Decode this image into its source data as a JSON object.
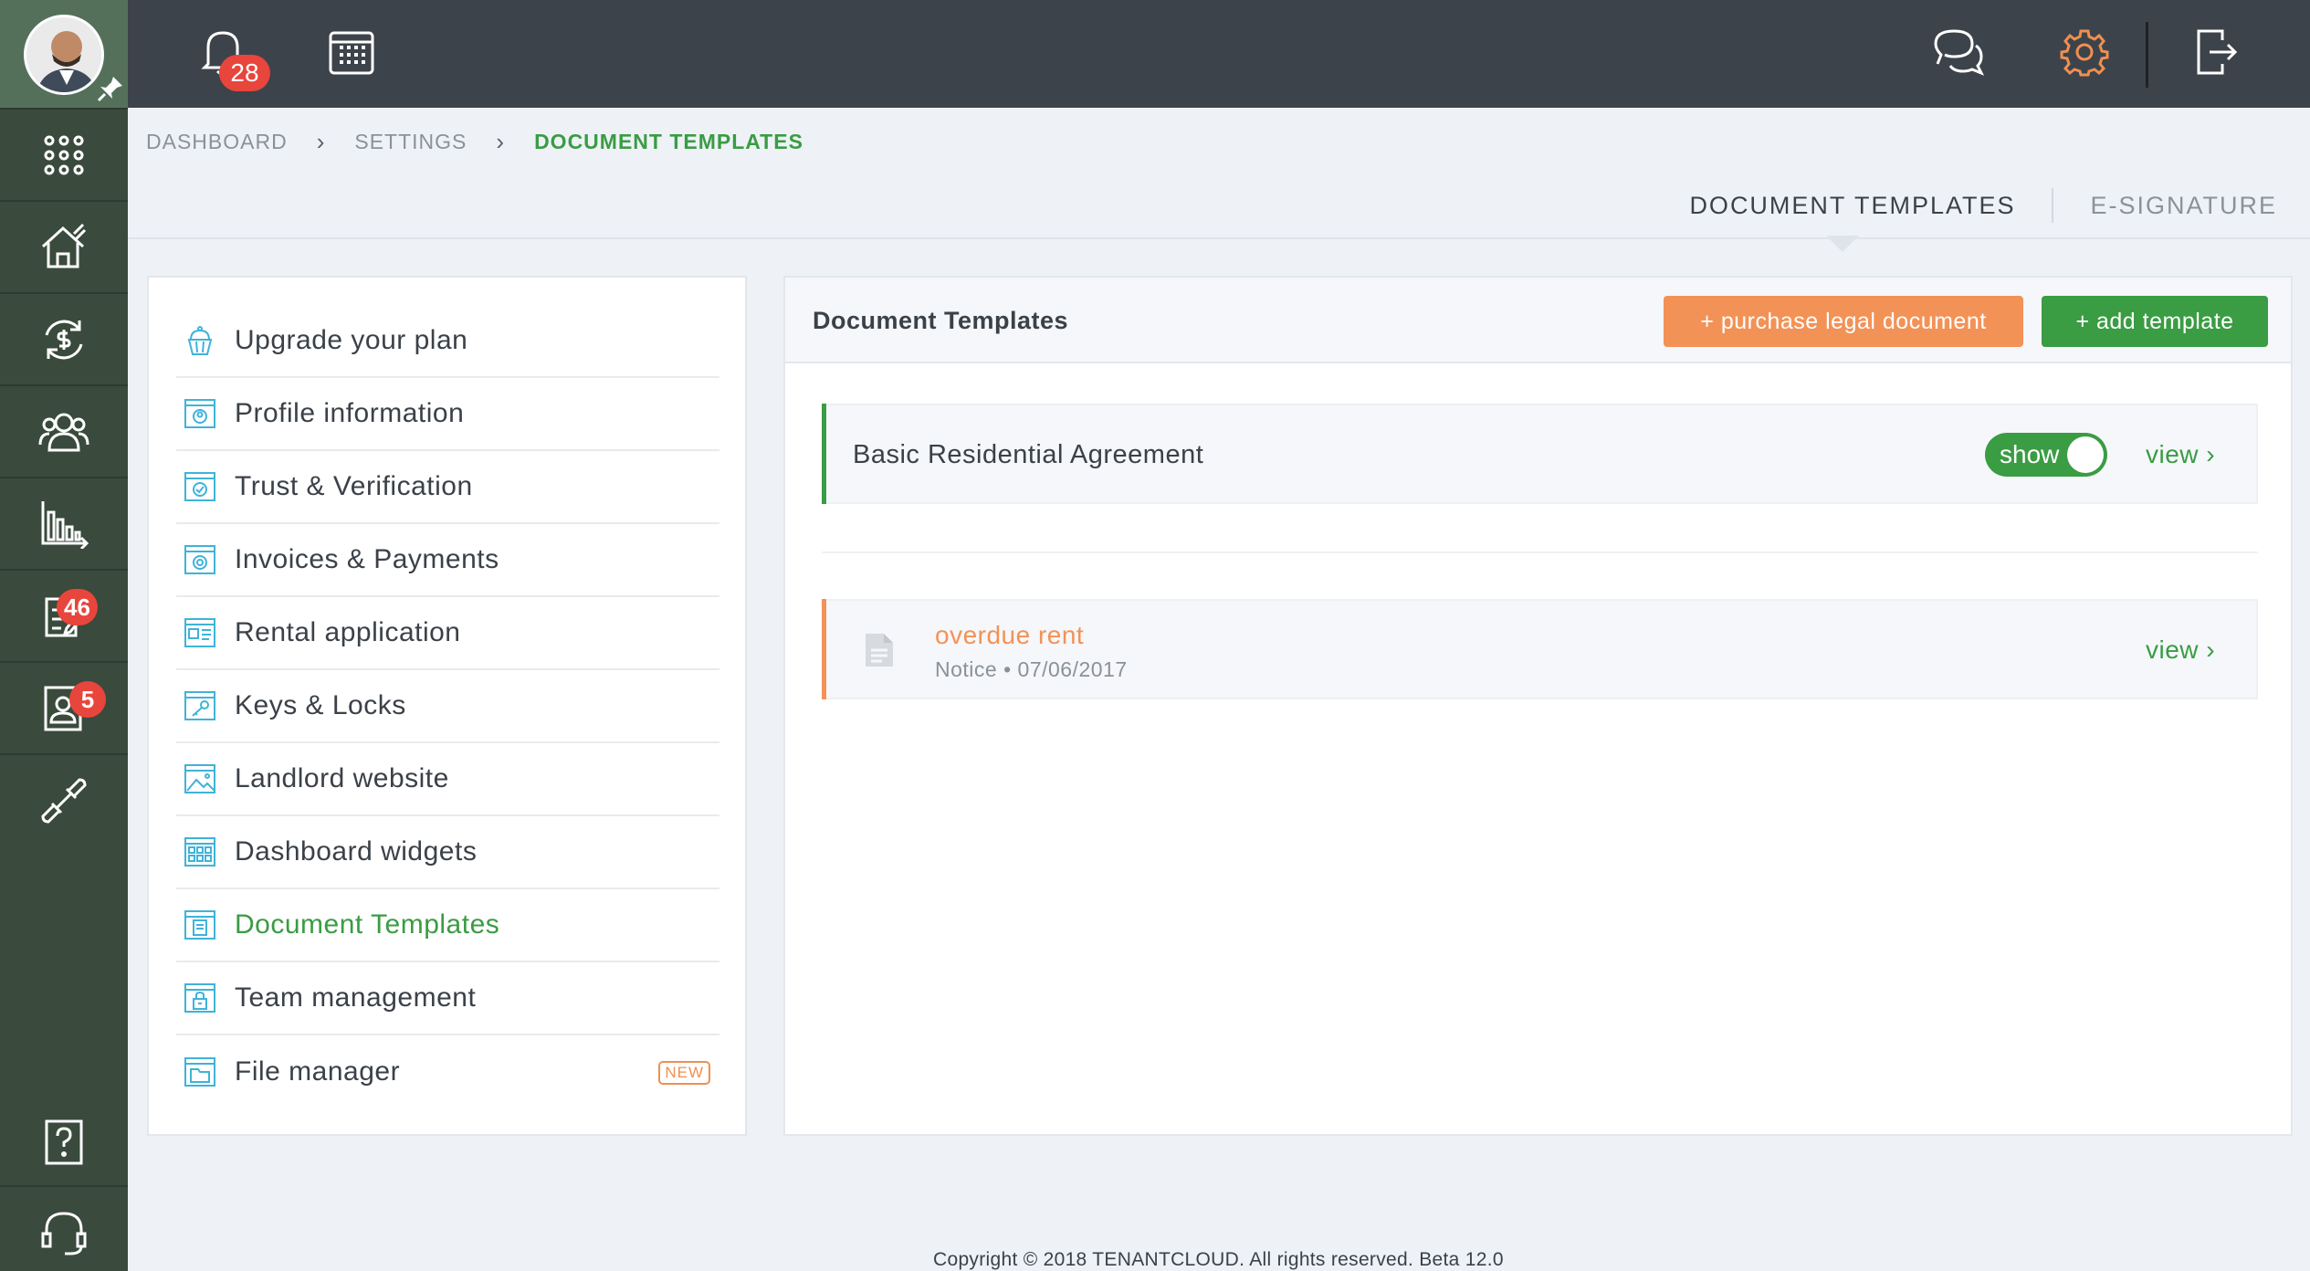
{
  "topbar": {
    "notification_count": "28",
    "icons": [
      "bell-icon",
      "calendar-icon",
      "chat-icon",
      "gear-icon",
      "logout-icon"
    ],
    "accent_gear_color": "#f08f52"
  },
  "sidebar": {
    "nav": [
      {
        "name": "apps-grid-icon"
      },
      {
        "name": "properties-icon"
      },
      {
        "name": "accounting-icon"
      },
      {
        "name": "tenants-icon"
      },
      {
        "name": "reports-icon"
      },
      {
        "name": "applications-icon",
        "badge": "46"
      },
      {
        "name": "contacts-icon",
        "badge": "5"
      },
      {
        "name": "integrations-icon"
      },
      {
        "name": "help-icon"
      },
      {
        "name": "support-icon"
      }
    ]
  },
  "breadcrumb": {
    "items": [
      "DASHBOARD",
      "SETTINGS",
      "DOCUMENT TEMPLATES"
    ]
  },
  "page_tabs": {
    "document_templates": "DOCUMENT TEMPLATES",
    "e_signature": "E-SIGNATURE"
  },
  "settings_menu": {
    "items": [
      {
        "label": "Upgrade your plan",
        "icon": "cupcake-icon"
      },
      {
        "label": "Profile information",
        "icon": "profile-icon"
      },
      {
        "label": "Trust & Verification",
        "icon": "verification-icon"
      },
      {
        "label": "Invoices & Payments",
        "icon": "payments-icon"
      },
      {
        "label": "Rental application",
        "icon": "application-icon"
      },
      {
        "label": "Keys & Locks",
        "icon": "key-icon"
      },
      {
        "label": "Landlord website",
        "icon": "website-icon"
      },
      {
        "label": "Dashboard widgets",
        "icon": "widgets-icon"
      },
      {
        "label": "Document Templates",
        "icon": "document-icon",
        "active": true
      },
      {
        "label": "Team management",
        "icon": "team-icon"
      },
      {
        "label": "File manager",
        "icon": "folder-icon",
        "badge": "NEW"
      }
    ]
  },
  "main": {
    "title": "Document Templates",
    "purchase_button": "+ purchase legal document",
    "add_button": "+ add template",
    "template_row": {
      "title": "Basic Residential Agreement",
      "toggle_label": "show",
      "toggle_on": true,
      "view_label": "view ›"
    },
    "document_row": {
      "title": "overdue rent",
      "subtitle": "Notice • 07/06/2017",
      "view_label": "view ›"
    }
  },
  "footer": {
    "text": "Copyright © 2018 TENANTCLOUD. All rights reserved. Beta 12.0"
  }
}
